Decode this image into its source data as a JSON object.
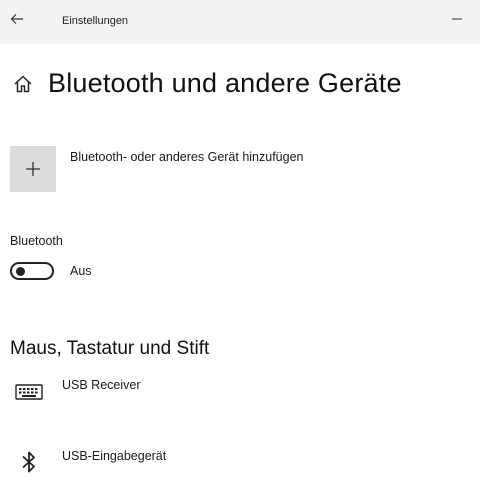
{
  "titlebar": {
    "back_icon": "arrow-left-icon",
    "title": "Einstellungen",
    "minimize_icon": "minimize-icon"
  },
  "header": {
    "home_icon": "home-icon",
    "title": "Bluetooth und andere Geräte"
  },
  "add_device": {
    "icon": "plus-icon",
    "label": "Bluetooth- oder anderes Gerät hinzufügen"
  },
  "bluetooth": {
    "label": "Bluetooth",
    "toggle_on": false,
    "state_label": "Aus"
  },
  "section": {
    "title": "Maus, Tastatur und Stift"
  },
  "devices": [
    {
      "icon": "keyboard-icon",
      "name": "USB Receiver"
    },
    {
      "icon": "bluetooth-icon",
      "name": "USB-Eingabegerät"
    }
  ],
  "colors": {
    "titlebar_bg": "#f3f3f3",
    "tile_bg": "#dcdcdc",
    "text": "#1a1a1a"
  }
}
